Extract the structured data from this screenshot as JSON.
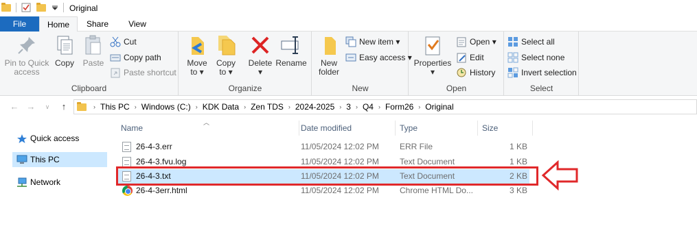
{
  "window": {
    "title": "Original"
  },
  "tabs": {
    "file": "File",
    "home": "Home",
    "share": "Share",
    "view": "View"
  },
  "ribbon": {
    "clipboard": {
      "label": "Clipboard",
      "pin_line1": "Pin to Quick",
      "pin_line2": "access",
      "copy": "Copy",
      "paste": "Paste",
      "cut": "Cut",
      "copy_path": "Copy path",
      "paste_shortcut": "Paste shortcut"
    },
    "organize": {
      "label": "Organize",
      "move_line1": "Move",
      "move_line2": "to",
      "copy_line1": "Copy",
      "copy_line2": "to",
      "delete": "Delete",
      "rename": "Rename"
    },
    "new": {
      "label": "New",
      "folder_line1": "New",
      "folder_line2": "folder",
      "new_item": "New item",
      "easy_access": "Easy access"
    },
    "open": {
      "label": "Open",
      "properties": "Properties",
      "open": "Open",
      "edit": "Edit",
      "history": "History"
    },
    "select": {
      "label": "Select",
      "select_all": "Select all",
      "select_none": "Select none",
      "invert": "Invert selection"
    }
  },
  "address": {
    "crumbs": [
      "This PC",
      "Windows (C:)",
      "KDK Data",
      "Zen TDS",
      "2024-2025",
      "3",
      "Q4",
      "Form26",
      "Original"
    ]
  },
  "navpane": {
    "quick_access": "Quick access",
    "this_pc": "This PC",
    "network": "Network"
  },
  "columns": {
    "name": "Name",
    "date": "Date modified",
    "type": "Type",
    "size": "Size"
  },
  "files": [
    {
      "name": "26-4-3.err",
      "date": "11/05/2024 12:02 PM",
      "type": "ERR File",
      "size": "1 KB",
      "icon": "text-file-icon"
    },
    {
      "name": "26-4-3.fvu.log",
      "date": "11/05/2024 12:02 PM",
      "type": "Text Document",
      "size": "1 KB",
      "icon": "text-file-icon"
    },
    {
      "name": "26-4-3.txt",
      "date": "11/05/2024 12:02 PM",
      "type": "Text Document",
      "size": "2 KB",
      "icon": "text-file-icon",
      "selected": true
    },
    {
      "name": "26-4-3err.html",
      "date": "11/05/2024 12:02 PM",
      "type": "Chrome HTML Do...",
      "size": "3 KB",
      "icon": "chrome-icon"
    }
  ],
  "colors": {
    "accent": "#1c6bbf",
    "selection": "#cce8ff",
    "annotation": "#e0282a"
  }
}
